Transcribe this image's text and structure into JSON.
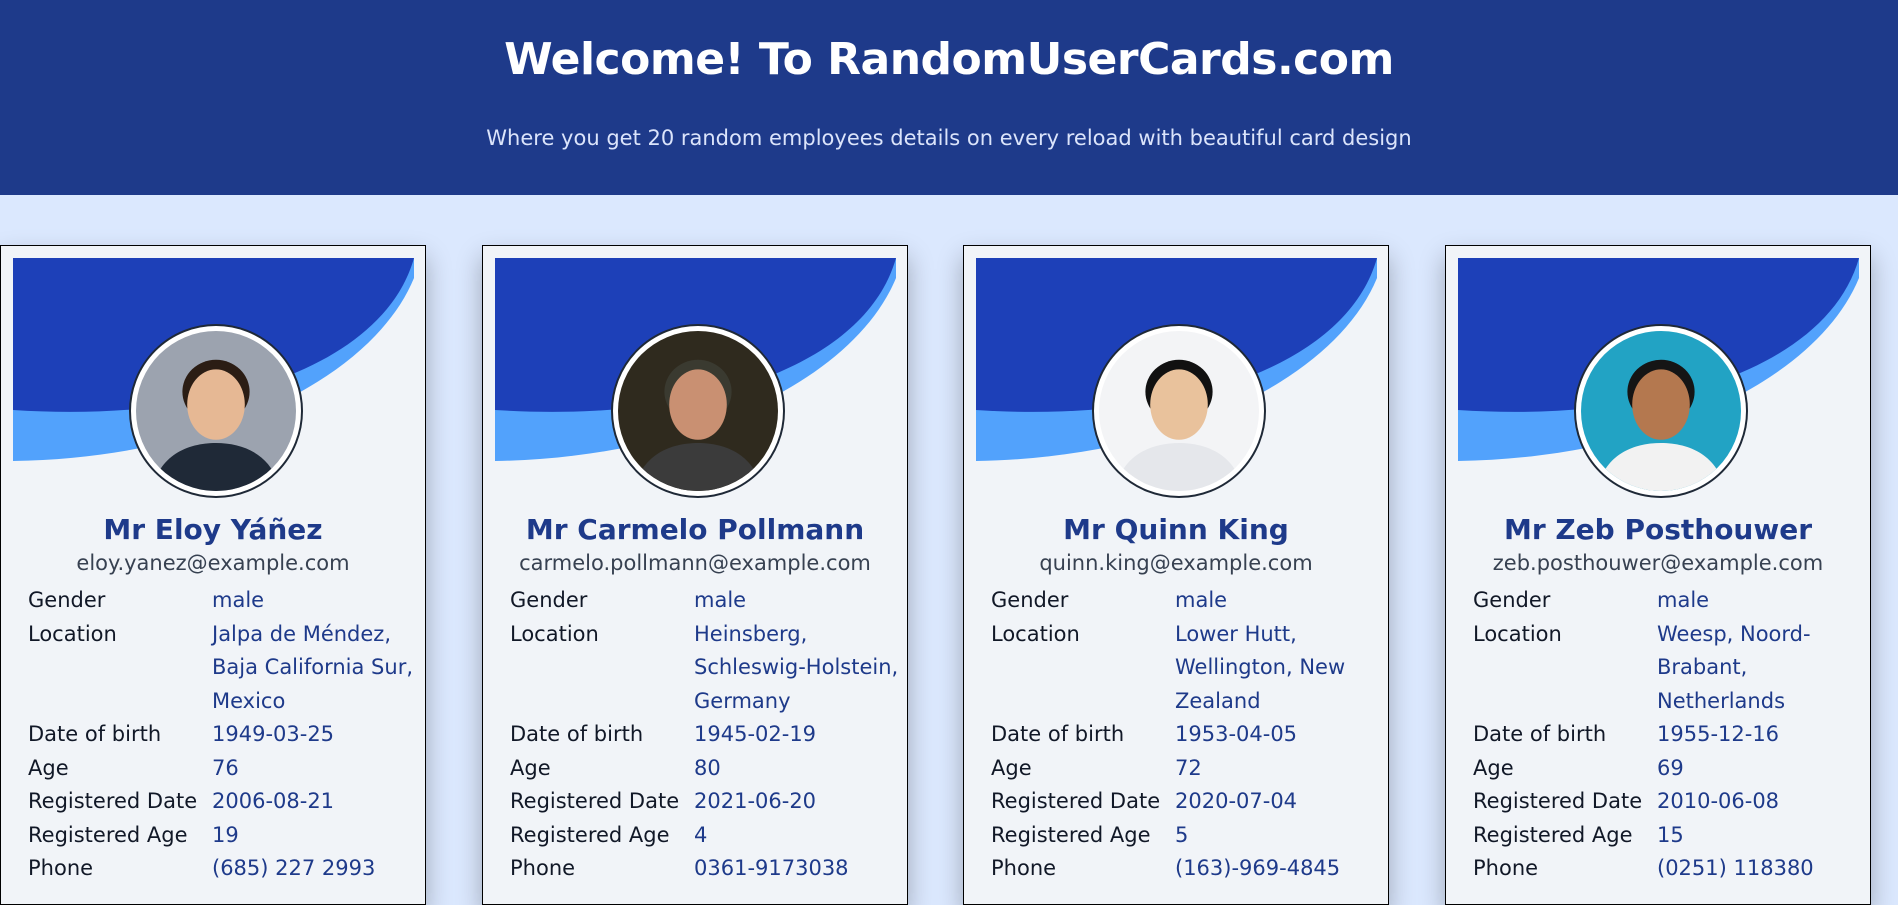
{
  "header": {
    "title": "Welcome! To RandomUserCards.com",
    "subtitle": "Where you get 20 random employees details on every reload with beautiful card design"
  },
  "colors": {
    "header_bg": "#1e3a8a",
    "page_bg": "#dbe8fe",
    "card_bg": "#f1f4f8",
    "banner_dark": "#1d40b8",
    "banner_light": "#52a2fc",
    "name_color": "#1e3a8a"
  },
  "labels": {
    "gender": "Gender",
    "location": "Location",
    "dob": "Date of birth",
    "age": "Age",
    "registered_date": "Registered Date",
    "registered_age": "Registered Age",
    "phone": "Phone"
  },
  "cards": [
    {
      "name": "Mr Eloy Yáñez",
      "email": "eloy.yanez@example.com",
      "gender": "male",
      "location": "Jalpa de Méndez, Baja California Sur, Mexico",
      "dob": "1949-03-25",
      "age": "76",
      "registered_date": "2006-08-21",
      "registered_age": "19",
      "phone": "(685) 227 2993",
      "avatar_icon": "user-photo-icon"
    },
    {
      "name": "Mr Carmelo Pollmann",
      "email": "carmelo.pollmann@example.com",
      "gender": "male",
      "location": "Heinsberg, Schleswig-Holstein, Germany",
      "dob": "1945-02-19",
      "age": "80",
      "registered_date": "2021-06-20",
      "registered_age": "4",
      "phone": "0361-9173038",
      "avatar_icon": "user-photo-icon"
    },
    {
      "name": "Mr Quinn King",
      "email": "quinn.king@example.com",
      "gender": "male",
      "location": "Lower Hutt, Wellington, New Zealand",
      "dob": "1953-04-05",
      "age": "72",
      "registered_date": "2020-07-04",
      "registered_age": "5",
      "phone": "(163)-969-4845",
      "avatar_icon": "user-photo-icon"
    },
    {
      "name": "Mr Zeb Posthouwer",
      "email": "zeb.posthouwer@example.com",
      "gender": "male",
      "location": "Weesp, Noord-Brabant, Netherlands",
      "dob": "1955-12-16",
      "age": "69",
      "registered_date": "2010-06-08",
      "registered_age": "15",
      "phone": "(0251) 118380",
      "avatar_icon": "user-photo-icon"
    }
  ]
}
